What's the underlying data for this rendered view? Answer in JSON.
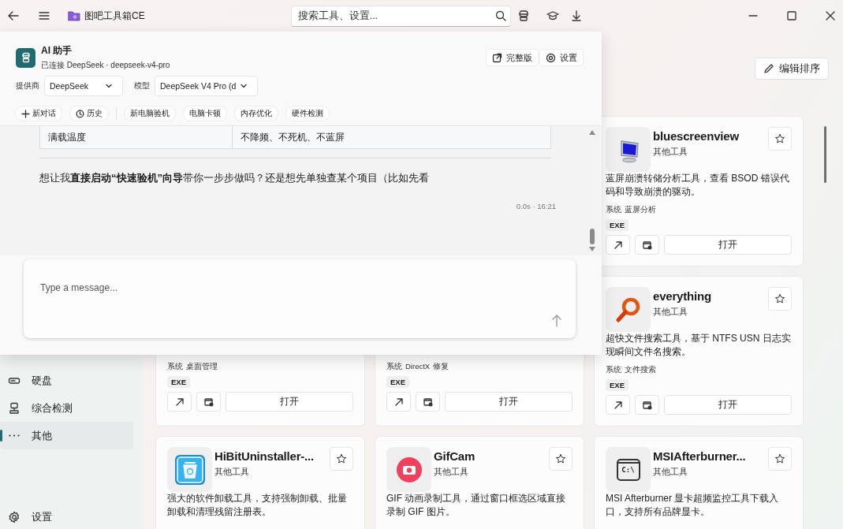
{
  "window": {
    "title": "图吧工具箱CE"
  },
  "search": {
    "placeholder": "搜索工具、设置..."
  },
  "edit_button": "编辑排序",
  "sidebar": {
    "items": [
      {
        "label": "硬盘",
        "selected": false
      },
      {
        "label": "综合检测",
        "selected": false
      },
      {
        "label": "其他",
        "selected": true
      }
    ],
    "settings": "设置"
  },
  "tool_cards": [
    {
      "title": "bluescreenview",
      "category": "其他工具",
      "icon": {
        "kind": "monitor"
      },
      "description": "蓝屏崩溃转储分析工具，查看 BSOD 错误代码和导致崩溃的驱动。",
      "tags": [
        "系统",
        "蓝屏分析"
      ],
      "badge": "EXE",
      "open_label": "打开"
    },
    {
      "tags": [
        "系统",
        "桌面管理"
      ],
      "badge": "EXE",
      "open_label": "打开"
    },
    {
      "tags": [
        "系统",
        "DirectX",
        "修复"
      ],
      "badge": "EXE",
      "open_label": "打开"
    },
    {
      "title": "everything",
      "category": "其他工具",
      "icon": {
        "kind": "magnifier"
      },
      "description": "超快文件搜索工具，基于 NTFS USN 日志实现瞬间文件名搜索。",
      "tags": [
        "系统",
        "文件搜索"
      ],
      "badge": "EXE",
      "open_label": "打开"
    },
    {
      "title": "HiBitUninstaller-...",
      "category": "其他工具",
      "icon": {
        "kind": "bin"
      },
      "description": "强大的软件卸载工具，支持强制卸载、批量卸载和清理残留注册表。"
    },
    {
      "title": "GifCam",
      "category": "其他工具",
      "icon": {
        "kind": "camera"
      },
      "description": "GIF 动画录制工具，通过窗口框选区域直接录制 GIF 图片。"
    },
    {
      "title": "MSIAfterburner...",
      "category": "其他工具",
      "icon": {
        "kind": "terminal",
        "text": "C:\\"
      },
      "description": "MSI Afterburner 显卡超频监控工具下载入口，支持所有品牌显卡。"
    }
  ],
  "ai_panel": {
    "title": "AI 助手",
    "status": "已连接 DeepSeek · deepseek-v4-pro",
    "buttons": [
      "完整版",
      "设置"
    ],
    "provider": {
      "label": "提供商",
      "value": "DeepSeek"
    },
    "model": {
      "label": "模型",
      "value": "DeepSeek V4 Pro (d"
    },
    "actions": [
      "新对话",
      "历史"
    ],
    "quick_prompts": [
      "新电脑验机",
      "电脑卡顿",
      "内存优化",
      "硬件检测"
    ],
    "table_row": [
      "满载温度",
      "不降频、不死机、不蓝屏"
    ],
    "message": "想让我**直接启动“快速验机”向导**带你一步步做吗？还是想先单独查某个项目（比如先看",
    "message_meta": "0.0s · 16:21",
    "input": {
      "placeholder": "Type a message..."
    }
  }
}
